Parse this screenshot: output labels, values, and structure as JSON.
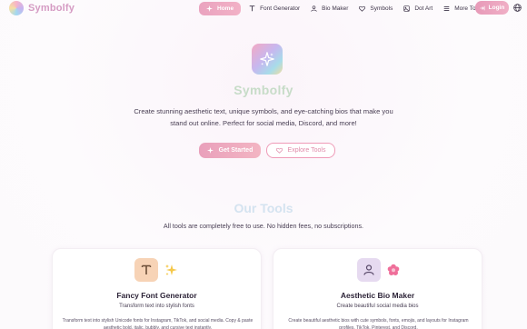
{
  "brand": {
    "name": "Symbolfy"
  },
  "nav": {
    "items": [
      {
        "label": "Home",
        "icon": "sparkle-icon",
        "active": true
      },
      {
        "label": "Font Generator",
        "icon": "type-icon"
      },
      {
        "label": "Bio Maker",
        "icon": "user-icon"
      },
      {
        "label": "Symbols",
        "icon": "heart-icon"
      },
      {
        "label": "Dot Art",
        "icon": "image-icon"
      },
      {
        "label": "More Tools",
        "icon": "menu-icon"
      }
    ],
    "login_label": "Login"
  },
  "hero": {
    "title": "Symbolfy",
    "subtitle": "Create stunning aesthetic text, unique symbols, and eye-catching bios that make you stand out online. Perfect for social media, Discord, and more!",
    "primary_cta": "Get Started",
    "secondary_cta": "Explore Tools"
  },
  "tools": {
    "title": "Our Tools",
    "subtitle": "All tools are completely free to use. No hidden fees, no subscriptions.",
    "cards": [
      {
        "title": "Fancy Font Generator",
        "subtitle": "Transform text into stylish fonts",
        "description": "Transform text into stylish Unicode fonts for Instagram, TikTok, and social media. Copy & paste aesthetic bold, italic, bubbly, and cursive text instantly."
      },
      {
        "title": "Aesthetic Bio Maker",
        "subtitle": "Create beautiful social media bios",
        "description": "Create beautiful aesthetic bios with cute symbols, fonts, emojis, and layouts for Instagram profiles, TikTok, Pinterest, and Discord."
      }
    ]
  },
  "colors": {
    "accent_pink": "#eaa3bf",
    "brand_pink": "#d59bc3",
    "text_dark": "#2d2438"
  }
}
